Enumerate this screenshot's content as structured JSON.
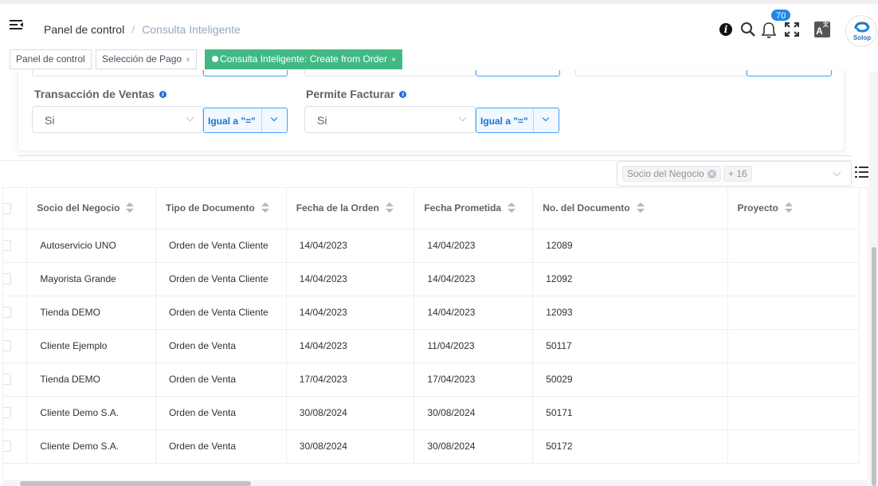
{
  "header": {
    "breadcrumb_home": "Panel de control",
    "breadcrumb_separator": "/",
    "breadcrumb_current": "Consulta Inteligente",
    "notification_count": "70",
    "language_label": "A",
    "language_sup": "文",
    "brand_text": "Solop",
    "icons": [
      "menu-icon",
      "info-icon",
      "search-icon",
      "bell-icon",
      "fullscreen-icon",
      "language-icon"
    ]
  },
  "tabs": [
    {
      "label": "Panel de control",
      "closable": false,
      "active": false
    },
    {
      "label": "Selección de Pago",
      "closable": true,
      "active": false
    },
    {
      "label": "Consulta Inteligente: Create from Order",
      "closable": true,
      "active": true
    }
  ],
  "tab_close": "×",
  "filters": {
    "transaccion": {
      "label": "Transacción de Ventas",
      "value": "Si",
      "operator": "Igual a \"=\""
    },
    "facturar": {
      "label": "Permite Facturar",
      "value": "Si",
      "operator": "Igual a \"=\""
    }
  },
  "column_selector": {
    "chip": "Socio del Negocio",
    "more": "+ 16"
  },
  "table": {
    "columns": [
      "Socio del Negocio",
      "Tipo de Documento",
      "Fecha de la Orden",
      "Fecha Prometida",
      "No. del Documento",
      "Proyecto"
    ],
    "rows": [
      [
        "Autoservicio UNO",
        "Orden de Venta Cliente",
        "14/04/2023",
        "14/04/2023",
        "12089",
        ""
      ],
      [
        "Mayorista Grande",
        "Orden de Venta Cliente",
        "14/04/2023",
        "14/04/2023",
        "12092",
        ""
      ],
      [
        "Tienda DEMO",
        "Orden de Venta Cliente",
        "14/04/2023",
        "14/04/2023",
        "12093",
        ""
      ],
      [
        "Cliente Ejemplo",
        "Orden de Venta",
        "14/04/2023",
        "11/04/2023",
        "50117",
        ""
      ],
      [
        "Tienda DEMO",
        "Orden de Venta",
        "17/04/2023",
        "17/04/2023",
        "50029",
        ""
      ],
      [
        "Cliente Demo S.A.",
        "Orden de Venta",
        "30/08/2024",
        "30/08/2024",
        "50171",
        ""
      ],
      [
        "Cliente Demo S.A.",
        "Orden de Venta",
        "30/08/2024",
        "30/08/2024",
        "50172",
        ""
      ]
    ]
  },
  "colors": {
    "active_tab": "#42b983",
    "primary": "#409eff",
    "badge": "#1e88e5"
  }
}
